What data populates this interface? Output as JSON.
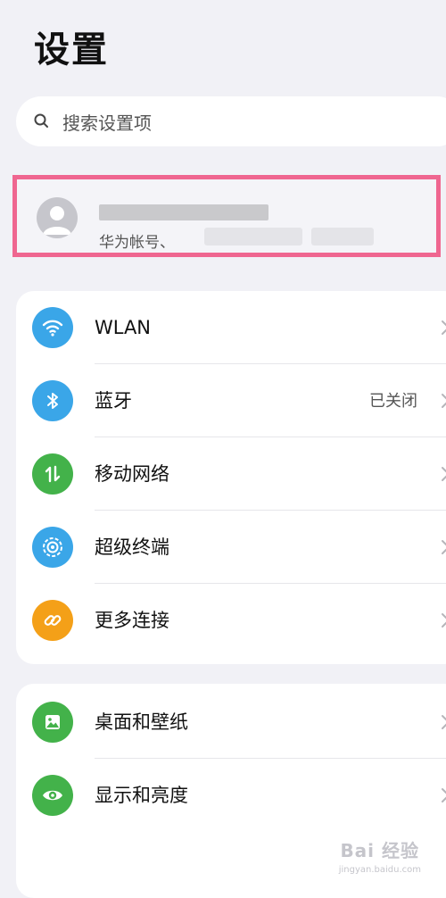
{
  "header": {
    "title": "设置"
  },
  "search": {
    "placeholder": "搜索设置项",
    "icon": "search-icon"
  },
  "account": {
    "subtitle": "华为帐号、",
    "avatar_icon": "person-icon",
    "highlight_color": "#ef6690"
  },
  "groups": [
    {
      "items": [
        {
          "label": "WLAN",
          "icon": "wifi-icon",
          "icon_color": "#3aa6e8",
          "value": ""
        },
        {
          "label": "蓝牙",
          "icon": "bluetooth-icon",
          "icon_color": "#3aa6e8",
          "value": "已关闭"
        },
        {
          "label": "移动网络",
          "icon": "mobile-data-icon",
          "icon_color": "#43b24a",
          "value": ""
        },
        {
          "label": "超级终端",
          "icon": "super-device-icon",
          "icon_color": "#3aa6e8",
          "value": ""
        },
        {
          "label": "更多连接",
          "icon": "link-icon",
          "icon_color": "#f4a018",
          "value": ""
        }
      ]
    },
    {
      "items": [
        {
          "label": "桌面和壁纸",
          "icon": "wallpaper-icon",
          "icon_color": "#43b24a",
          "value": ""
        },
        {
          "label": "显示和亮度",
          "icon": "eye-icon",
          "icon_color": "#43b24a",
          "value": ""
        }
      ]
    }
  ],
  "watermark": {
    "text": "Bai 经验",
    "sub": "jingyan.baidu.com"
  }
}
